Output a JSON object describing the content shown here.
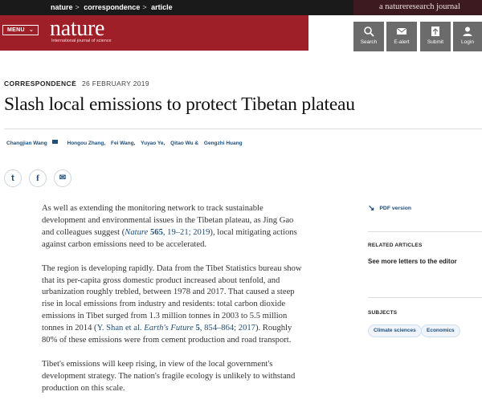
{
  "breadcrumb": [
    "nature",
    "correspondence",
    "article"
  ],
  "brand_banner": "a natureresearch journal",
  "header": {
    "menu_label": "MENU",
    "logo": "nature",
    "logo_subtitle": "International journal of science",
    "tools": [
      {
        "label": "Search",
        "icon": "search-icon"
      },
      {
        "label": "E-alert",
        "icon": "envelope-icon"
      },
      {
        "label": "Submit",
        "icon": "upload-icon"
      },
      {
        "label": "Login",
        "icon": "user-icon"
      }
    ]
  },
  "article": {
    "type": "CORRESPONDENCE",
    "date": "26 FEBRUARY 2019",
    "title": "Slash local emissions to protect Tibetan plateau",
    "authors": [
      "Changjian Wang",
      "Hongou Zhang,",
      "Fei Wang,",
      "Yuyao Ye,",
      "Qitao Wu &",
      "Gengzhi Huang"
    ],
    "share": [
      {
        "name": "twitter-icon",
        "glyph": "t"
      },
      {
        "name": "facebook-icon",
        "glyph": "f"
      },
      {
        "name": "email-icon",
        "glyph": "✉"
      }
    ],
    "p1_text": "As well as extending the monitoring network to track sustainable development and environmental issues in the Tibetan plateau, as Jing Gao and colleagues suggest (",
    "p1_cite_journal": "Nature",
    "p1_cite_vol": "565",
    "p1_cite_pages": ", 19–21; ",
    "p1_cite_year": "2019",
    "p1_tail": "), local mitigating actions against carbon emissions need to be accelerated.",
    "p2_text": "The region is developing rapidly. Data from the Tibet Statistics bureau show that its per-capita gross domestic product increased about tenfold, and urbanization roughly trebled, between 1978 and 2017. That caused a steep rise in local emissions from industry and residents: total carbon dioxide emissions in Tibet surged from 1.3 million tonnes in 2003 to 5.5 million tonnes in 2014 (",
    "p2_cite_authors": "Y. Shan et al.",
    "p2_cite_journal": "Earth's Future",
    "p2_cite_vol": "5",
    "p2_cite_pages": ", 854–864; ",
    "p2_cite_year": "2017",
    "p2_tail": "). Roughly 80% of these emissions were from cement production and road transport.",
    "p3_text": "Tibet's emissions will keep rising, in view of the local government's development strategy. The nation's fragile ecology is unlikely to withstand production on this scale."
  },
  "sidebar": {
    "pdf_label": "PDF version",
    "related_heading": "RELATED ARTICLES",
    "related_link": "See more letters to the editor",
    "subjects_heading": "SUBJECTS",
    "subjects": [
      "Climate sciences",
      "Economics"
    ]
  }
}
